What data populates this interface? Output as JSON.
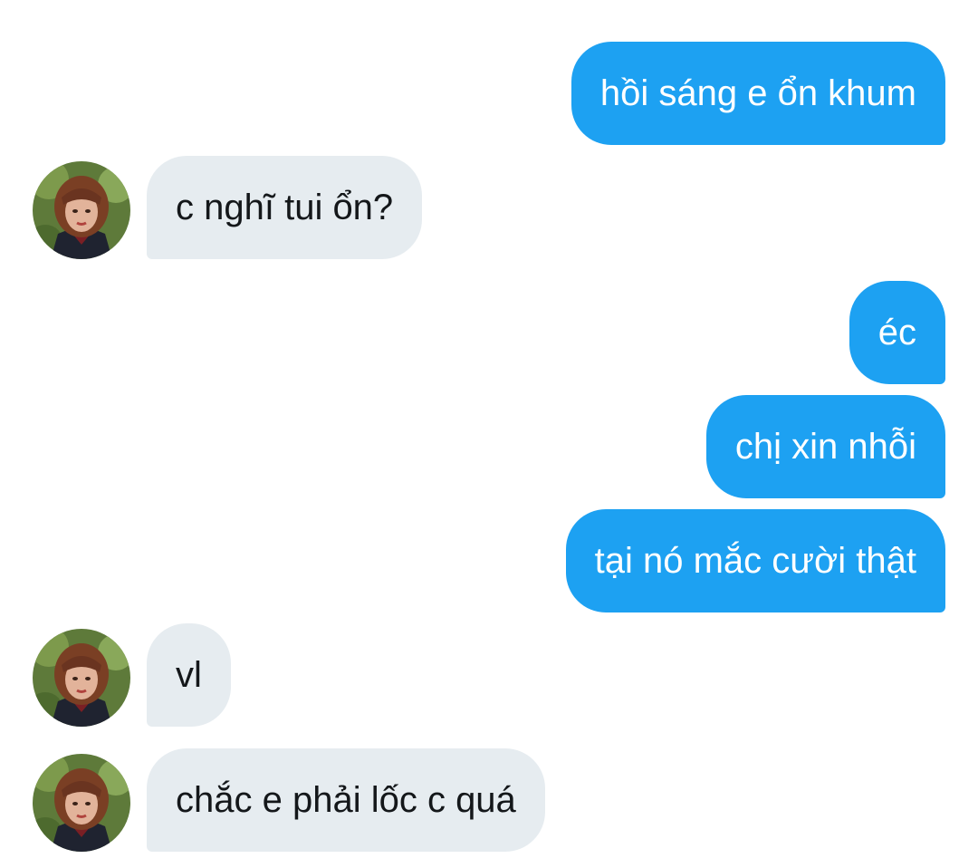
{
  "conversation": {
    "messages": [
      {
        "direction": "outgoing",
        "text": "hồi sáng e ổn khum"
      },
      {
        "direction": "incoming",
        "text": "c nghĩ tui ổn?",
        "avatar": "contact-avatar"
      },
      {
        "direction": "outgoing",
        "text": "éc"
      },
      {
        "direction": "outgoing",
        "text": "chị xin nhỗi"
      },
      {
        "direction": "outgoing",
        "text": "tại nó mắc cười thật"
      },
      {
        "direction": "incoming",
        "text": "vl",
        "avatar": "contact-avatar"
      },
      {
        "direction": "incoming",
        "text": "chắc e phải lốc c quá",
        "avatar": "contact-avatar"
      }
    ]
  },
  "colors": {
    "outgoing_bubble": "#1da1f2",
    "incoming_bubble": "#e6ecf0",
    "outgoing_text": "#ffffff",
    "incoming_text": "#14171a",
    "background": "#ffffff"
  }
}
